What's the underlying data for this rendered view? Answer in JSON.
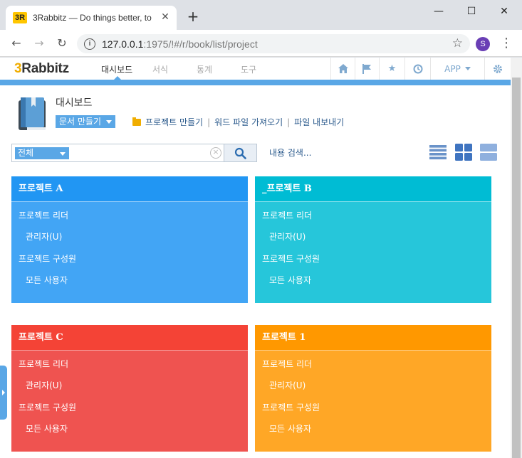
{
  "browser": {
    "tab_title": "3Rabbitz — Do things better, to",
    "favicon_text": "3R",
    "url_host": "127.0.0.1",
    "url_port": ":1975",
    "url_path": "/!#/r/book/list/project",
    "profile_initial": "S"
  },
  "app": {
    "brand_prefix": "3",
    "brand_rest": "Rabbitz",
    "nav": [
      "대시보드",
      "서식",
      "통계",
      "도구"
    ],
    "active_nav": "대시보드",
    "app_menu_label": "APP",
    "accent_color": "#5aa7e6"
  },
  "header": {
    "title": "대시보드",
    "doc_dropdown": "문서 만들기",
    "actions": [
      "프로젝트 만들기",
      "워드 파일 가져오기",
      "파일 내보내기"
    ]
  },
  "search": {
    "scope": "전체",
    "query": "",
    "content_search_link": "내용 검색..."
  },
  "projects": [
    {
      "title": "프로젝트 A",
      "color_head": "#2196f3",
      "color_body": "#42a5f5",
      "leader_label": "프로젝트 리더",
      "leader": "관리자(U)",
      "members_label": "프로젝트 구성원",
      "members": "모든 사용자"
    },
    {
      "title": "_프로젝트 B",
      "color_head": "#00bcd4",
      "color_body": "#26c6da",
      "leader_label": "프로젝트 리더",
      "leader": "관리자(U)",
      "members_label": "프로젝트 구성원",
      "members": "모든 사용자"
    },
    {
      "title": "프로젝트 C",
      "color_head": "#f44336",
      "color_body": "#ef5350",
      "leader_label": "프로젝트 리더",
      "leader": "관리자(U)",
      "members_label": "프로젝트 구성원",
      "members": "모든 사용자"
    },
    {
      "title": "프로젝트 1",
      "color_head": "#ff9800",
      "color_body": "#ffa726",
      "leader_label": "프로젝트 리더",
      "leader": "관리자(U)",
      "members_label": "프로젝트 구성원",
      "members": "모든 사용자"
    }
  ]
}
